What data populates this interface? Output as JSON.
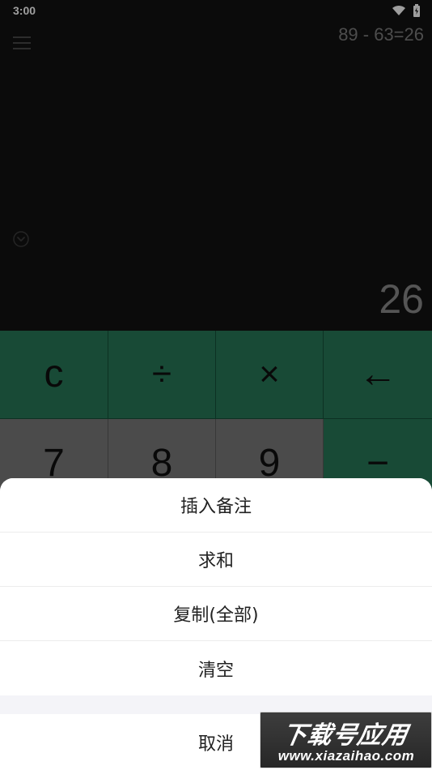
{
  "status_bar": {
    "time": "3:00",
    "icons": [
      "wifi-icon",
      "battery-icon"
    ]
  },
  "display": {
    "expression": "89 - 63=26",
    "result": "26",
    "menu_icon": "hamburger-menu-icon",
    "collapse_icon": "chevron-down-circle-icon"
  },
  "keypad": {
    "row1": [
      "c",
      "÷",
      "×",
      "←"
    ],
    "row2": [
      "7",
      "8",
      "9",
      "−"
    ]
  },
  "action_sheet": {
    "items": [
      "插入备注",
      "求和",
      "复制(全部)",
      "清空"
    ],
    "cancel": "取消"
  },
  "watermark": {
    "title": "下载号应用",
    "url": "www.xiazaihao.com"
  },
  "colors": {
    "display_bg": "#121212",
    "operator_key": "#287858",
    "number_key": "#7a7a7a",
    "sheet_bg": "#ffffff"
  }
}
